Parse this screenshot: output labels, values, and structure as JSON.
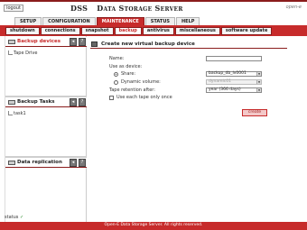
{
  "header": {
    "logout_label": "logout",
    "product": "DSS",
    "product_sub": "Data Storage Server",
    "logo_text": "open-e"
  },
  "main_tabs": [
    "SETUP",
    "CONFIGURATION",
    "MAINTENANCE",
    "STATUS",
    "HELP"
  ],
  "sub_tabs": [
    "shutdown",
    "connections",
    "snapshot",
    "backup",
    "antivirus",
    "miscellaneous",
    "software update"
  ],
  "sidebar": {
    "backup_devices": {
      "title": "Backup devices",
      "items": [
        "Tape Drive"
      ]
    },
    "backup_tasks": {
      "title": "Backup Tasks",
      "items": [
        "task1"
      ]
    },
    "data_replication": {
      "title": "Data replication"
    }
  },
  "panel": {
    "title": "Create new virtual backup device",
    "name_label": "Name:",
    "name_value": "",
    "use_as_label": "Use as device:",
    "share_label": "Share:",
    "share_value": "backup_db_lv0001",
    "dynamic_label": "Dynamic volume:",
    "dynamic_value": "dynamic01",
    "retention_label": "Tape retention after:",
    "retention_value": "year (366 days)",
    "use_once_label": "Use each tape only once",
    "create_label": "create"
  },
  "status": {
    "label": "status",
    "check": "✓"
  },
  "footer": {
    "text": "Open-E Data Storage Server. All rights reserved."
  },
  "colors": {
    "accent": "#c72b2b",
    "accent_dark": "#8a1c1c"
  }
}
